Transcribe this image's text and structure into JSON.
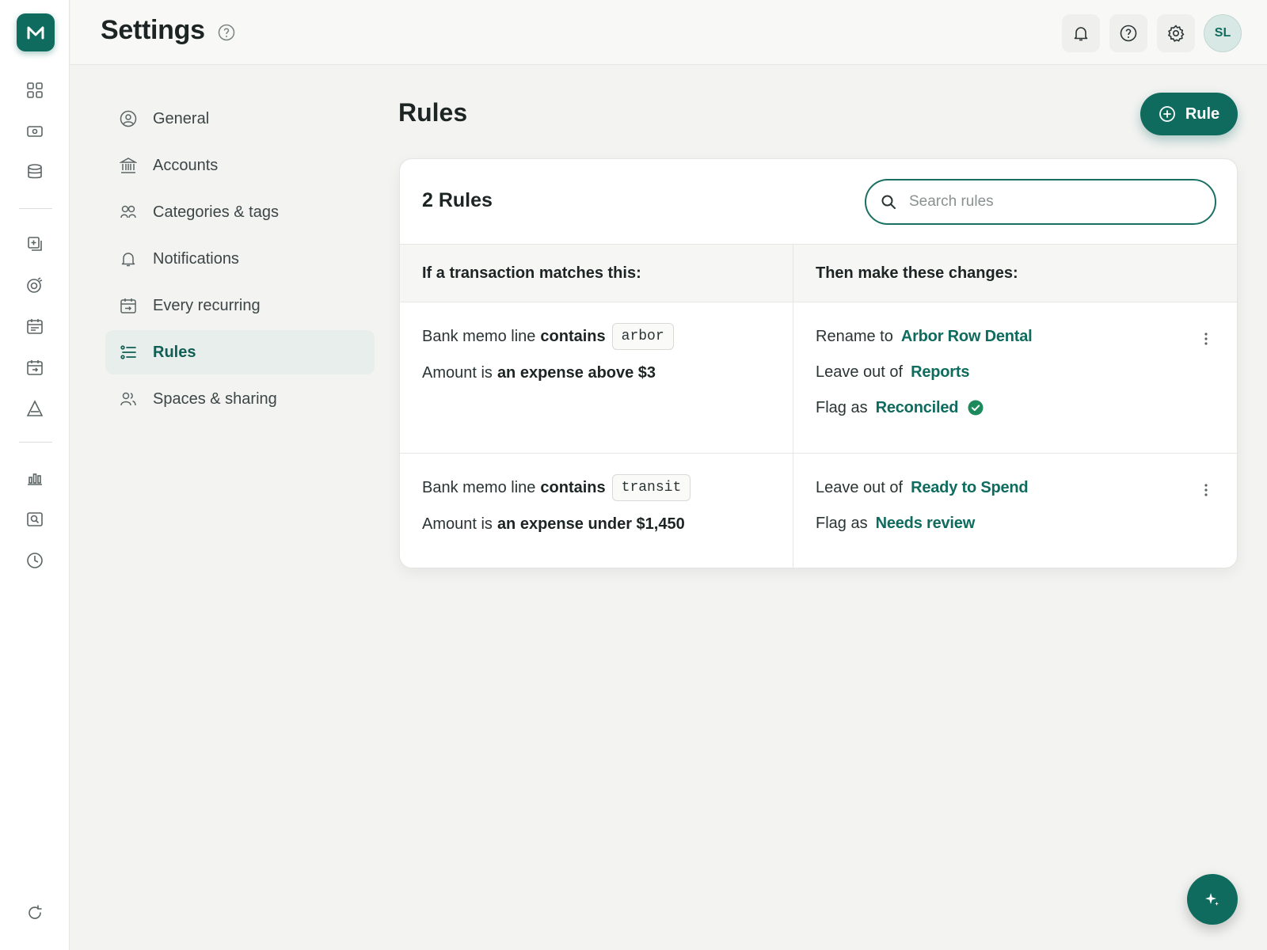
{
  "brand": {
    "logo_text": "M",
    "accent_color": "#0f6b5e"
  },
  "rail": {
    "icons": [
      "dashboard-icon",
      "accounts-icon",
      "database-icon",
      "transactions-icon",
      "goals-icon",
      "calendar-icon",
      "recurring-icon",
      "investments-icon",
      "reports-icon",
      "search-reports-icon",
      "history-icon"
    ],
    "bottom_icon": "refresh-icon"
  },
  "header": {
    "title": "Settings",
    "help_icon": "help-icon",
    "actions": [
      "bell-icon",
      "help-icon",
      "gear-icon"
    ],
    "avatar_initials": "SL"
  },
  "settings_nav": {
    "items": [
      {
        "label": "General",
        "icon": "user-circle-icon"
      },
      {
        "label": "Accounts",
        "icon": "bank-icon"
      },
      {
        "label": "Categories & tags",
        "icon": "categories-icon"
      },
      {
        "label": "Notifications",
        "icon": "bell-icon"
      },
      {
        "label": "Every recurring",
        "icon": "calendar-recurring-icon"
      },
      {
        "label": "Rules",
        "icon": "rules-icon",
        "active": true
      },
      {
        "label": "Spaces & sharing",
        "icon": "users-icon"
      }
    ]
  },
  "rules_page": {
    "title": "Rules",
    "add_button_label": "Rule",
    "count_label": "2 Rules",
    "search_placeholder": "Search rules",
    "columns": {
      "conditions": "If a transaction matches this:",
      "actions": "Then make these changes:"
    },
    "rules": [
      {
        "memo_prefix": "Bank memo line",
        "memo_operator": "contains",
        "memo_value": "arbor",
        "amount_prefix": "Amount is",
        "amount_condition": "an expense above $3",
        "actions": [
          {
            "prefix": "Rename to",
            "value": "Arbor Row Dental"
          },
          {
            "prefix": "Leave out of",
            "value": "Reports"
          },
          {
            "prefix": "Flag as",
            "value": "Reconciled",
            "badge": "check-circle-icon"
          }
        ]
      },
      {
        "memo_prefix": "Bank memo line",
        "memo_operator": "contains",
        "memo_value": "transit",
        "amount_prefix": "Amount is",
        "amount_condition": "an expense under $1,450",
        "actions": [
          {
            "prefix": "Leave out of",
            "value": "Ready to Spend"
          },
          {
            "prefix": "Flag as",
            "value": "Needs review"
          }
        ]
      }
    ]
  }
}
